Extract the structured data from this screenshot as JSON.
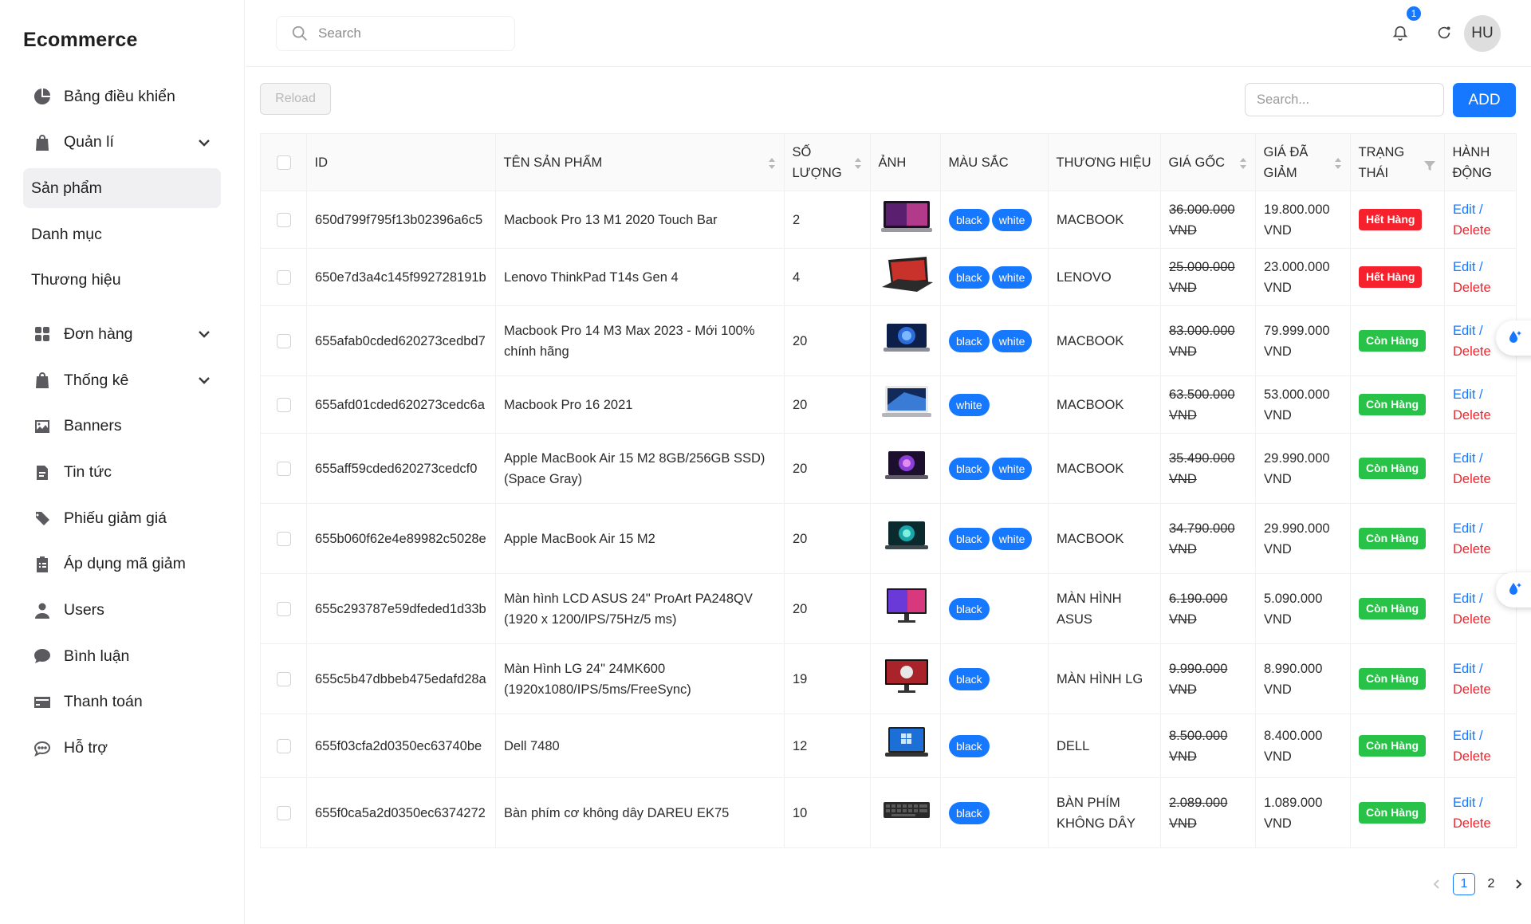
{
  "app": {
    "brand": "Ecommerce"
  },
  "sidebar": {
    "items": [
      {
        "label": "Bảng điều khiển",
        "icon": "pie-chart-icon"
      },
      {
        "label": "Quản lí",
        "icon": "shopping-bag-icon",
        "expandable": true
      },
      {
        "label": "Sản phẩm",
        "sub": true,
        "active": true
      },
      {
        "label": "Danh mục",
        "sub": true
      },
      {
        "label": "Thương hiệu",
        "sub": true
      },
      {
        "label": "Đơn hàng",
        "icon": "grid-icon",
        "expandable": true
      },
      {
        "label": "Thống kê",
        "icon": "shopping-bag-icon",
        "expandable": true
      },
      {
        "label": "Banners",
        "icon": "image-icon"
      },
      {
        "label": "Tin tức",
        "icon": "document-icon"
      },
      {
        "label": "Phiếu giảm giá",
        "icon": "tags-icon"
      },
      {
        "label": "Áp dụng mã giảm",
        "icon": "clipboard-list-icon"
      },
      {
        "label": "Users",
        "icon": "user-icon"
      },
      {
        "label": "Bình luận",
        "icon": "comment-icon"
      },
      {
        "label": "Thanh toán",
        "icon": "credit-card-icon"
      },
      {
        "label": "Hỗ trợ",
        "icon": "chat-dots-icon"
      }
    ]
  },
  "header": {
    "search_placeholder": "Search",
    "notification_count": "1",
    "avatar_initials": "HU"
  },
  "toolbar": {
    "reload_label": "Reload",
    "search_placeholder": "Search...",
    "add_label": "ADD"
  },
  "table": {
    "columns": [
      "ID",
      "TÊN SẢN PHẨM",
      "SỐ LƯỢNG",
      "ẢNH",
      "MÀU SẮC",
      "THƯƠNG HIỆU",
      "GIÁ GỐC",
      "GIÁ ĐÃ GIẢM",
      "TRẠNG THÁI",
      "HÀNH ĐỘNG"
    ],
    "edit_label": "Edit /",
    "delete_label": "Delete",
    "rows": [
      {
        "id": "650d799f795f13b02396a6c5",
        "name": "Macbook Pro 13 M1 2020 Touch Bar",
        "qty": "2",
        "image": "macbook-screen",
        "colors": [
          "black",
          "white"
        ],
        "brand": "MACBOOK",
        "price": "36.000.000 VND",
        "sale": "19.800.000 VND",
        "status": "Hết Hàng",
        "status_type": "out"
      },
      {
        "id": "650e7d3a4c145f992728191b",
        "name": "Lenovo ThinkPad T14s Gen 4",
        "qty": "4",
        "image": "thinkpad",
        "colors": [
          "black",
          "white"
        ],
        "brand": "LENOVO",
        "price": "25.000.000 VND",
        "sale": "23.000.000 VND",
        "status": "Hết Hàng",
        "status_type": "out"
      },
      {
        "id": "655afab0cded620273cedbd7",
        "name": "Macbook Pro 14 M3 Max 2023 - Mới 100% chính hãng",
        "qty": "20",
        "image": "macbook-blue",
        "colors": [
          "black",
          "white"
        ],
        "brand": "MACBOOK",
        "price": "83.000.000 VND",
        "sale": "79.999.000 VND",
        "status": "Còn Hàng",
        "status_type": "in"
      },
      {
        "id": "655afd01cded620273cedc6a",
        "name": "Macbook Pro 16 2021",
        "qty": "20",
        "image": "macbook-silver",
        "colors": [
          "white"
        ],
        "brand": "MACBOOK",
        "price": "63.500.000 VND",
        "sale": "53.000.000 VND",
        "status": "Còn Hàng",
        "status_type": "in"
      },
      {
        "id": "655aff59cded620273cedcf0",
        "name": "Apple MacBook Air 15 M2 8GB/256GB SSD) (Space Gray)",
        "qty": "20",
        "image": "macbook-purple",
        "colors": [
          "black",
          "white"
        ],
        "brand": "MACBOOK",
        "price": "35.490.000 VND",
        "sale": "29.990.000 VND",
        "status": "Còn Hàng",
        "status_type": "in"
      },
      {
        "id": "655b060f62e4e89982c5028e",
        "name": "Apple MacBook Air 15 M2",
        "qty": "20",
        "image": "macbook-teal",
        "colors": [
          "black",
          "white"
        ],
        "brand": "MACBOOK",
        "price": "34.790.000 VND",
        "sale": "29.990.000 VND",
        "status": "Còn Hàng",
        "status_type": "in"
      },
      {
        "id": "655c293787e59dfeded1d33b",
        "name": "Màn hình LCD ASUS 24\" ProArt PA248QV (1920 x 1200/IPS/75Hz/5 ms)",
        "qty": "20",
        "image": "asus-monitor",
        "colors": [
          "black"
        ],
        "brand": "MÀN HÌNH ASUS",
        "price": "6.190.000 VND",
        "sale": "5.090.000 VND",
        "status": "Còn Hàng",
        "status_type": "in"
      },
      {
        "id": "655c5b47dbbeb475edafd28a",
        "name": "Màn Hình LG 24\" 24MK600 (1920x1080/IPS/5ms/FreeSync)",
        "qty": "19",
        "image": "lg-monitor",
        "colors": [
          "black"
        ],
        "brand": "MÀN HÌNH LG",
        "price": "9.990.000 VND",
        "sale": "8.990.000 VND",
        "status": "Còn Hàng",
        "status_type": "in"
      },
      {
        "id": "655f03cfa2d0350ec63740be",
        "name": "Dell 7480",
        "qty": "12",
        "image": "dell-laptop",
        "colors": [
          "black"
        ],
        "brand": "DELL",
        "price": "8.500.000 VND",
        "sale": "8.400.000 VND",
        "status": "Còn Hàng",
        "status_type": "in"
      },
      {
        "id": "655f0ca5a2d0350ec6374272",
        "name": "Bàn phím cơ không dây DAREU EK75",
        "qty": "10",
        "image": "keyboard",
        "colors": [
          "black"
        ],
        "brand": "BÀN PHÍM KHÔNG DÂY",
        "price": "2.089.000 VND",
        "sale": "1.089.000 VND",
        "status": "Còn Hàng",
        "status_type": "in"
      }
    ]
  },
  "pagination": {
    "pages": [
      "1",
      "2"
    ],
    "current": "1"
  },
  "colors": {
    "accent": "#1677ff",
    "danger": "#f5222d",
    "success": "#29c249"
  }
}
